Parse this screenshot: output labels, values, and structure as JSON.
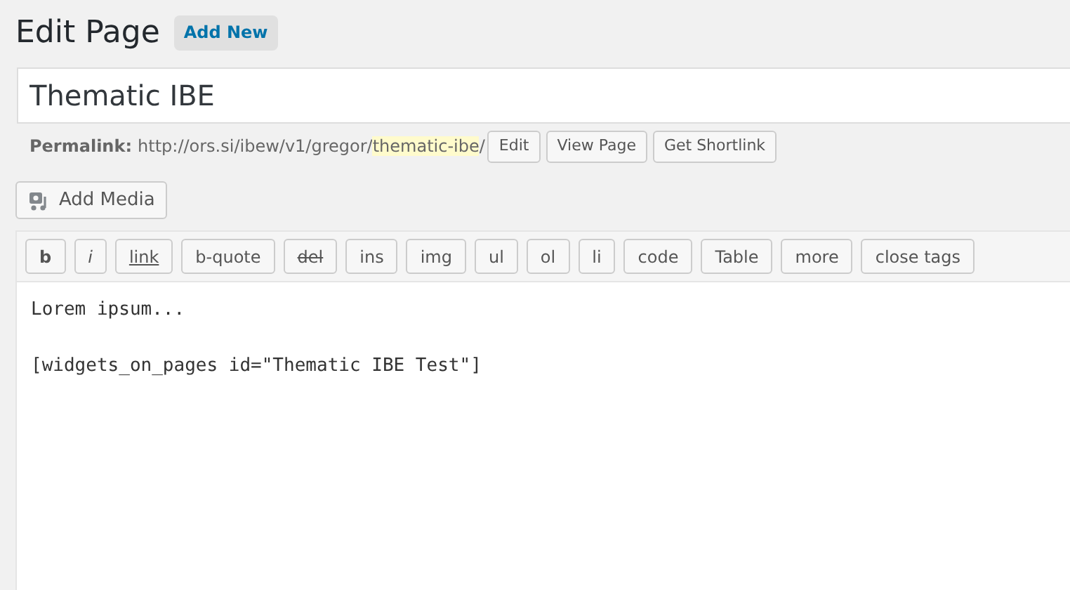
{
  "heading": "Edit Page",
  "add_new": "Add New",
  "title_field": {
    "value": "Thematic IBE"
  },
  "permalink": {
    "label": "Permalink:",
    "base": "http://ors.si/ibew/v1/gregor/",
    "slug": "thematic-ibe",
    "end": "/",
    "buttons": [
      "Edit",
      "View Page",
      "Get Shortlink"
    ]
  },
  "add_media": "Add Media",
  "quicktags": [
    {
      "label": "b",
      "kind": "bold"
    },
    {
      "label": "i",
      "kind": "italic"
    },
    {
      "label": "link",
      "kind": "underline"
    },
    {
      "label": "b-quote",
      "kind": "plain"
    },
    {
      "label": "del",
      "kind": "strike"
    },
    {
      "label": "ins",
      "kind": "plain"
    },
    {
      "label": "img",
      "kind": "plain"
    },
    {
      "label": "ul",
      "kind": "plain"
    },
    {
      "label": "ol",
      "kind": "plain"
    },
    {
      "label": "li",
      "kind": "plain"
    },
    {
      "label": "code",
      "kind": "plain"
    },
    {
      "label": "Table",
      "kind": "plain"
    },
    {
      "label": "more",
      "kind": "plain"
    },
    {
      "label": "close tags",
      "kind": "plain"
    }
  ],
  "editor_lines": [
    "Lorem ipsum...",
    "[widgets_on_pages id=\"Thematic IBE Test\"]"
  ]
}
